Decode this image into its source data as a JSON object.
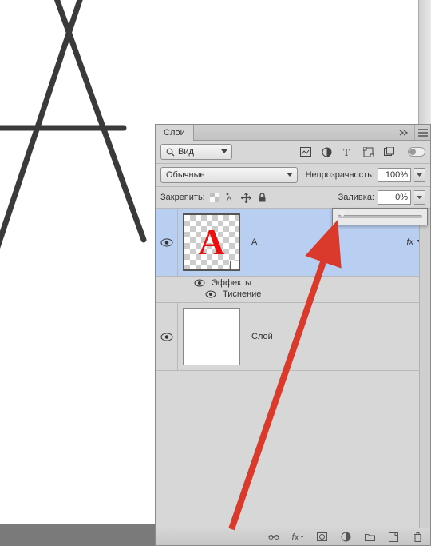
{
  "canvas": {
    "big_letter": "A"
  },
  "panel": {
    "tab_label": "Слои",
    "search_label": "Вид",
    "blend_mode": "Обычные",
    "opacity_label": "Непрозрачность:",
    "opacity_value": "100%",
    "lock_label": "Закрепить:",
    "fill_label": "Заливка:",
    "fill_value": "0%",
    "layers": [
      {
        "name": "A",
        "thumb_glyph": "А",
        "selected": true,
        "visible": true,
        "is_text": true,
        "has_fx": true,
        "effects_label": "Эффекты",
        "effects": [
          {
            "name": "Тиснение",
            "visible": true
          }
        ]
      },
      {
        "name": "Слой",
        "selected": false,
        "visible": true,
        "is_text": false,
        "has_fx": false
      }
    ]
  },
  "slider": {
    "position_pct": 0
  },
  "annotation_arrow": {
    "color": "#d93a2b"
  }
}
